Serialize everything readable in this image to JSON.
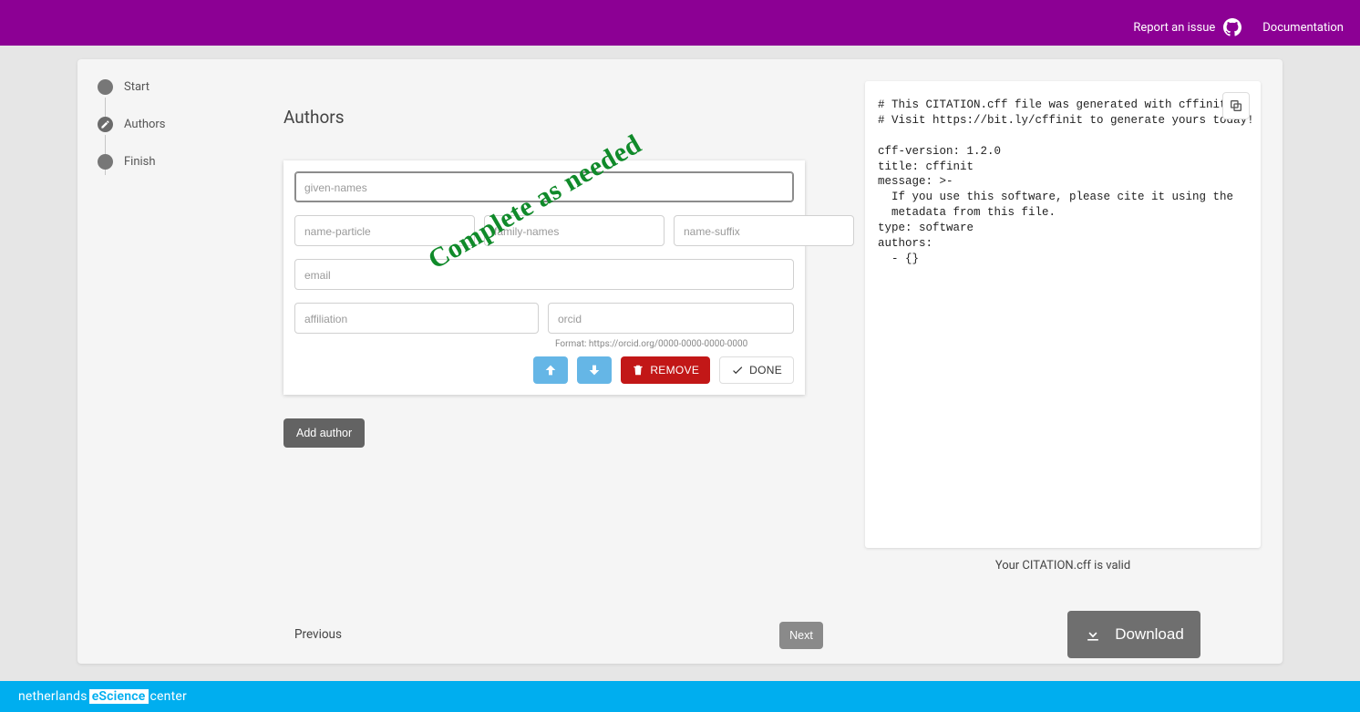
{
  "header": {
    "report_issue": "Report an issue",
    "documentation": "Documentation"
  },
  "steps": {
    "start": "Start",
    "authors": "Authors",
    "finish": "Finish"
  },
  "form": {
    "heading": "Authors",
    "placeholders": {
      "given_names": "given-names",
      "name_particle": "name-particle",
      "family_names": "family-names",
      "name_suffix": "name-suffix",
      "email": "email",
      "affiliation": "affiliation",
      "orcid": "orcid"
    },
    "orcid_hint": "Format: https://orcid.org/0000-0000-0000-0000",
    "remove": "REMOVE",
    "done": "DONE",
    "add_author": "Add author"
  },
  "preview": {
    "text": "# This CITATION.cff file was generated with cffinit.\n# Visit https://bit.ly/cffinit to generate yours today!\n\ncff-version: 1.2.0\ntitle: cffinit\nmessage: >-\n  If you use this software, please cite it using the\n  metadata from this file.\ntype: software\nauthors:\n  - {}"
  },
  "valid_message": "Your CITATION.cff is valid",
  "nav": {
    "previous": "Previous",
    "next": "Next",
    "download": "Download"
  },
  "annotation": "Complete as needed",
  "footer": {
    "pre": "netherlands ",
    "mid": "Science",
    "post": " center",
    "lead_e": "e"
  }
}
